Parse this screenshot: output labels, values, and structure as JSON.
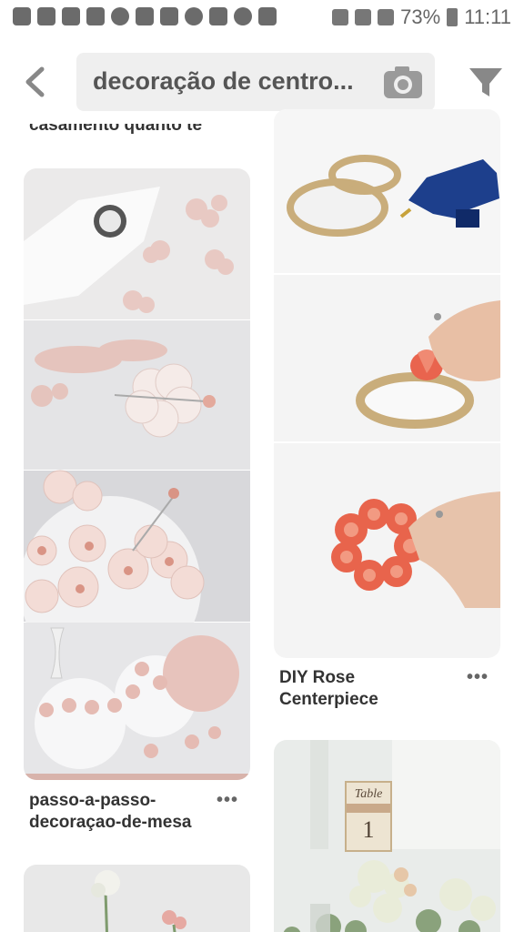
{
  "status_bar": {
    "battery": "73%",
    "time": "11:11"
  },
  "search": {
    "query": "decoração de centro..."
  },
  "feed": {
    "cut_off_title": "casamento quanto te",
    "pins": [
      {
        "title_line1": "passo-a-passo-",
        "title_line2": "decoraçao-de-mesa",
        "more": "•••"
      },
      {
        "title_line1": "DIY Rose",
        "title_line2": "Centerpiece",
        "more": "•••"
      }
    ],
    "table_card_text": "Table",
    "table_card_number": "1"
  },
  "colors": {
    "icon_gray": "#777777",
    "search_bg": "#efefef",
    "blush": "#e8c9c3",
    "burlap": "#c9ad7b",
    "rose": "#e86a4f"
  }
}
